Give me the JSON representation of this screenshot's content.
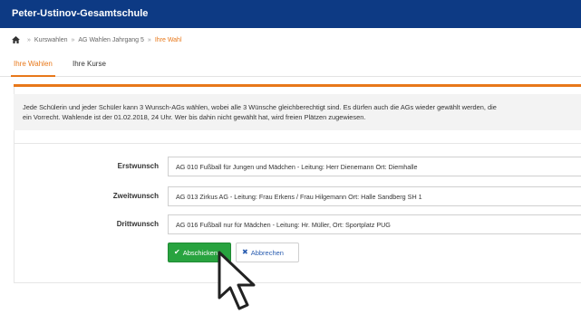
{
  "header": {
    "title": "Peter-Ustinov-Gesamtschule"
  },
  "breadcrumb": {
    "home_icon": "home-icon",
    "separator": "»",
    "items": [
      "Kurswahlen",
      "AG Wahlen Jahrgang 5",
      "Ihre Wahl"
    ]
  },
  "tabs": [
    {
      "label": "Ihre Wahlen",
      "active": true
    },
    {
      "label": "Ihre Kurse",
      "active": false
    }
  ],
  "info": {
    "line1": "Jede Schülerin und jeder Schüler kann 3 Wunsch-AGs wählen, wobei alle 3 Wünsche gleichberechtigt sind. Es dürfen auch die AGs wieder gewählt werden, die",
    "line2": "ein Vorrecht. Wahlende ist der 01.02.2018, 24 Uhr. Wer bis dahin nicht gewählt hat, wird freien Plätzen zugewiesen."
  },
  "form": {
    "fields": [
      {
        "label": "Erstwunsch",
        "value": "AG 010 Fußball für Jungen und Mädchen - Leitung: Herr Dienemann Ort: Diemhalle"
      },
      {
        "label": "Zweitwunsch",
        "value": "AG 013 Zirkus AG - Leitung: Frau Erkens / Frau Hilgemann Ort: Halle Sandberg SH 1"
      },
      {
        "label": "Drittwunsch",
        "value": "AG 016 Fußball nur für Mädchen - Leitung: Hr. Müller, Ort: Sportplatz PUG"
      }
    ]
  },
  "buttons": {
    "submit": {
      "label": "Abschicken",
      "icon": "check-icon"
    },
    "cancel": {
      "label": "Abbrechen",
      "icon": "close-icon"
    }
  },
  "colors": {
    "header_bg": "#0d3a84",
    "accent": "#e8781a",
    "submit_bg": "#28a33f",
    "cancel_text": "#2a5db0"
  }
}
